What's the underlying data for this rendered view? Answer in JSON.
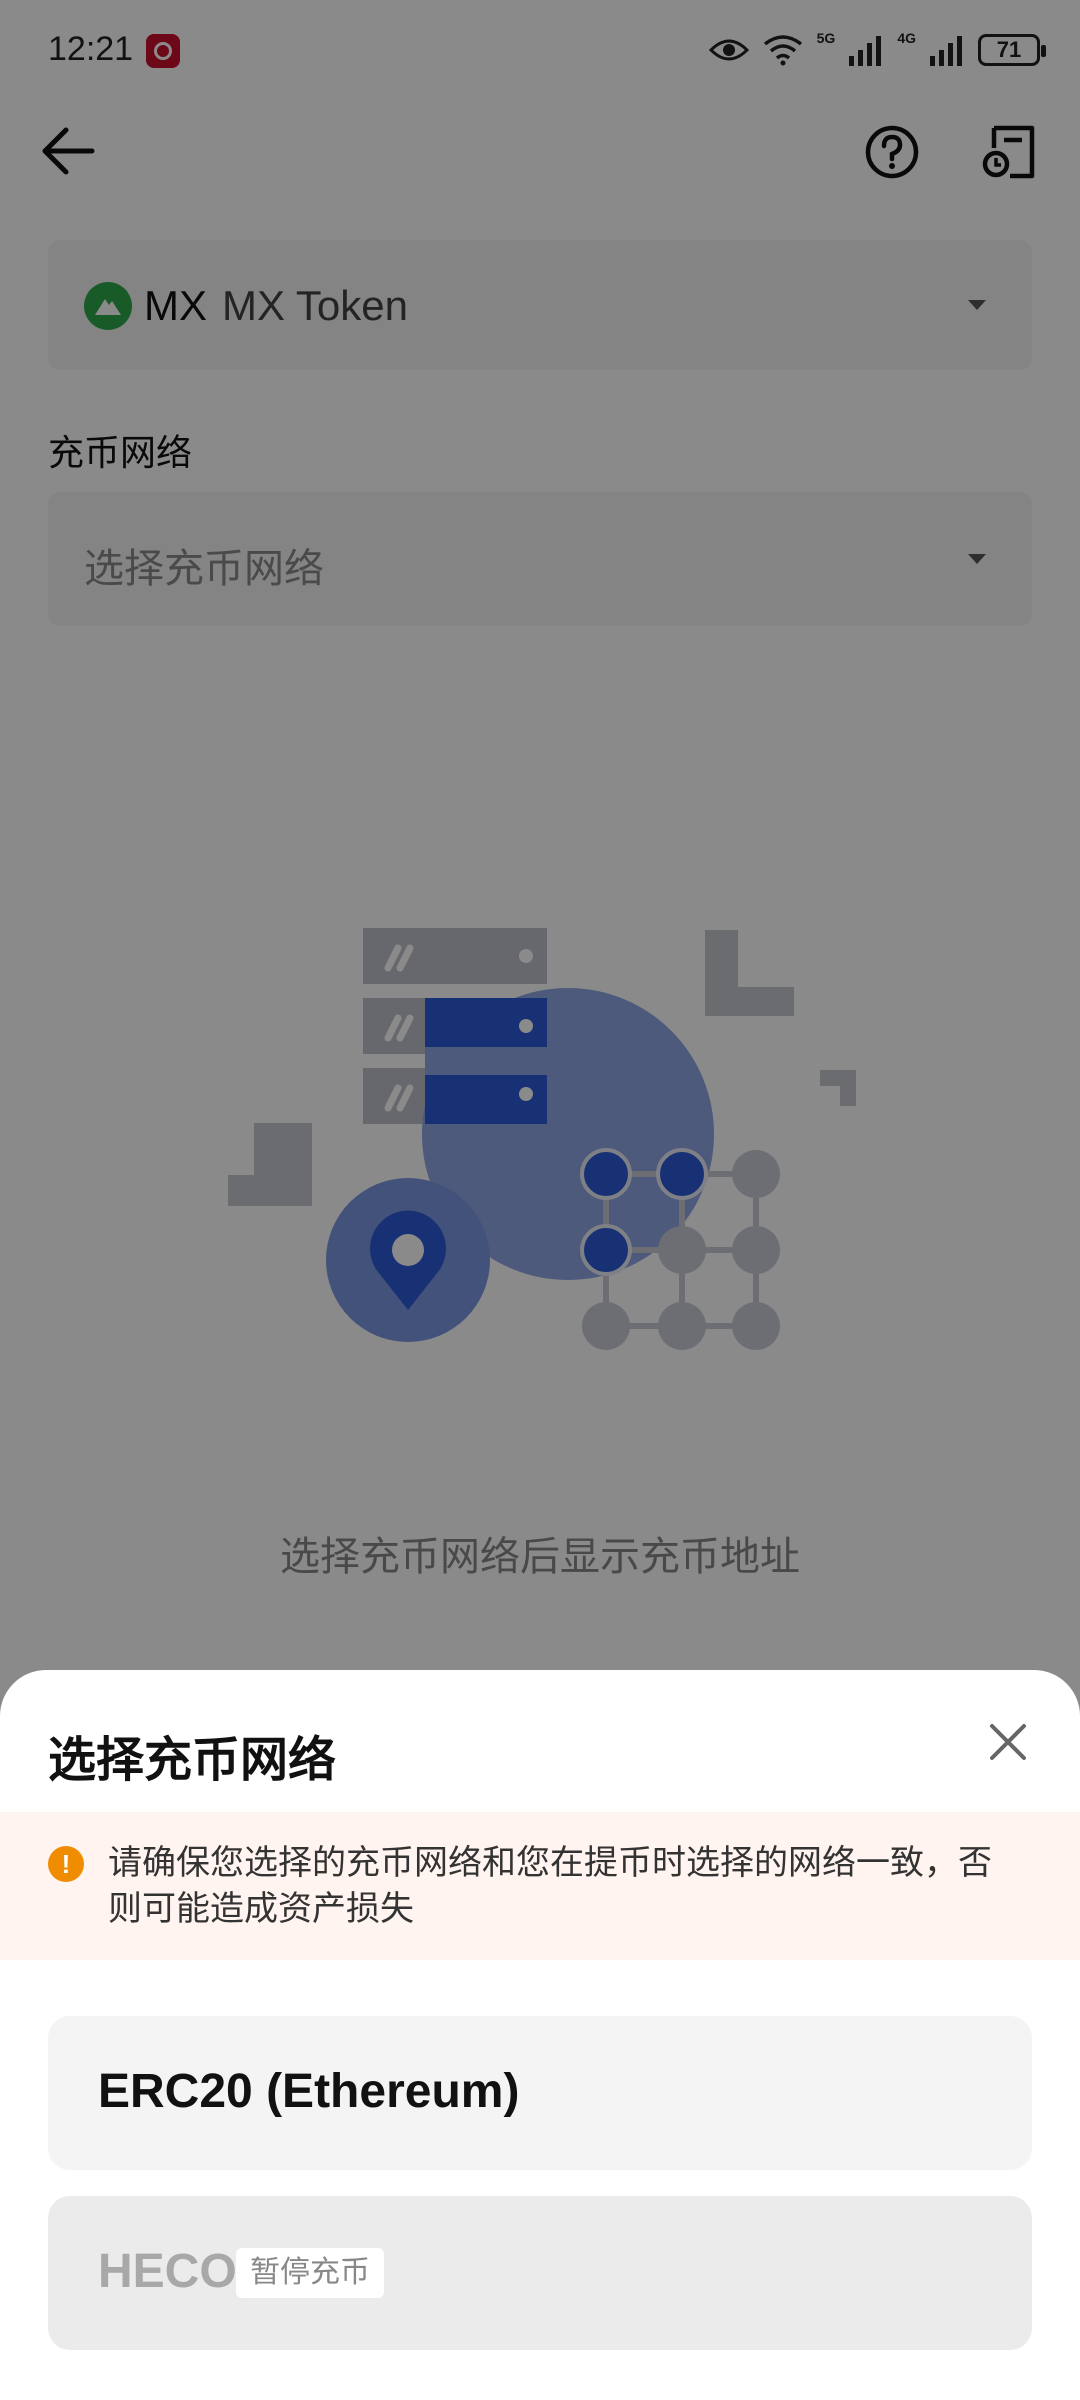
{
  "status_bar": {
    "time": "12:21",
    "battery": "71",
    "network_1": "5G",
    "network_2": "4G"
  },
  "header": {
    "back_icon": "arrow-left-icon",
    "help_icon": "question-circle-icon",
    "records_icon": "records-icon"
  },
  "token": {
    "symbol": "MX",
    "name": "MX Token",
    "icon_color": "#2ea84a"
  },
  "network_section": {
    "label": "充币网络",
    "placeholder": "选择充币网络"
  },
  "empty_state": {
    "message": "选择充币网络后显示充币地址",
    "illustration_color": "#2d5bd6"
  },
  "sheet": {
    "title": "选择充币网络",
    "warning": "请确保您选择的充币网络和您在提币时选择的网络一致，否则可能造成资产损失",
    "warning_color": "#f08c00",
    "options": [
      {
        "label": "ERC20 (Ethereum)",
        "badge": ""
      },
      {
        "label": "HECO",
        "badge": "暂停充币"
      }
    ]
  }
}
